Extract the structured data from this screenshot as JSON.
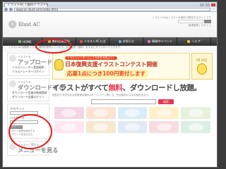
{
  "browser": {
    "tab_title": "イラストAC | 無料イラスト素材",
    "url": "www.ac-illust.com/index.html"
  },
  "header": {
    "logo_text": "Illust AC",
    "top_text": "イラストACはイラストを無料で配布するサイトです",
    "links_text": "新規登録 | ログイン"
  },
  "nav": [
    {
      "label": "HOME",
      "key": "home"
    },
    {
      "label": "無料会員登録",
      "key": "signup"
    },
    {
      "label": "イラストACとは",
      "key": "illust"
    },
    {
      "label": "お知らせ",
      "key": "news"
    },
    {
      "label": "開催中イベント",
      "key": "event"
    },
    {
      "label": "ヘルプ",
      "key": "help"
    }
  ],
  "notice": "イラストACは無料イラスト素材を配布しています。会員登録（無料）をするとダウンロードできます。",
  "sidebar": {
    "upload": {
      "small": "イラストを",
      "title": "アップロードする",
      "links": [
        "イラストレーター登録規約",
        "イラストレーターログイン"
      ]
    },
    "download": {
      "small": "イラストを",
      "title": "ダウンロードする",
      "links": [
        "ダウンロード会員の新規登録",
        "ダウンロード会員ログイン"
      ]
    },
    "login": {
      "account_label": "アカウント",
      "password_label": "パスワード",
      "button": "ログイン",
      "remember": "ログイン状態を保存する",
      "forgot": "パスワードを忘れた方"
    },
    "menu": {
      "small": "イラストに関する",
      "title": "メニューを見る"
    }
  },
  "banner": {
    "tag": "イラストレーターとして日本を元気よう！",
    "title": "日本復興支援イラストコンテスト開催",
    "subtitle": "応募1点につき100円寄付します",
    "pr_text": "PR 24日"
  },
  "main": {
    "headline_before": "イラストがすべて",
    "headline_free": "無料",
    "headline_after": "、ダウンロードし放題。",
    "subline": "個性的で可作性ある商業権利無料のホームページ等にも、完全無料のまま利用出来ます。",
    "search_button": "検索",
    "search_placeholder": ""
  },
  "thumb_colors": [
    "#f3d6e4",
    "#fbe3d2",
    "#d9ecf8",
    "#fff0c9",
    "#e6f2dc",
    "#fde6ef",
    "#f6e7cf",
    "#e1e8f6",
    "#f7dce1",
    "#dcefe2"
  ]
}
